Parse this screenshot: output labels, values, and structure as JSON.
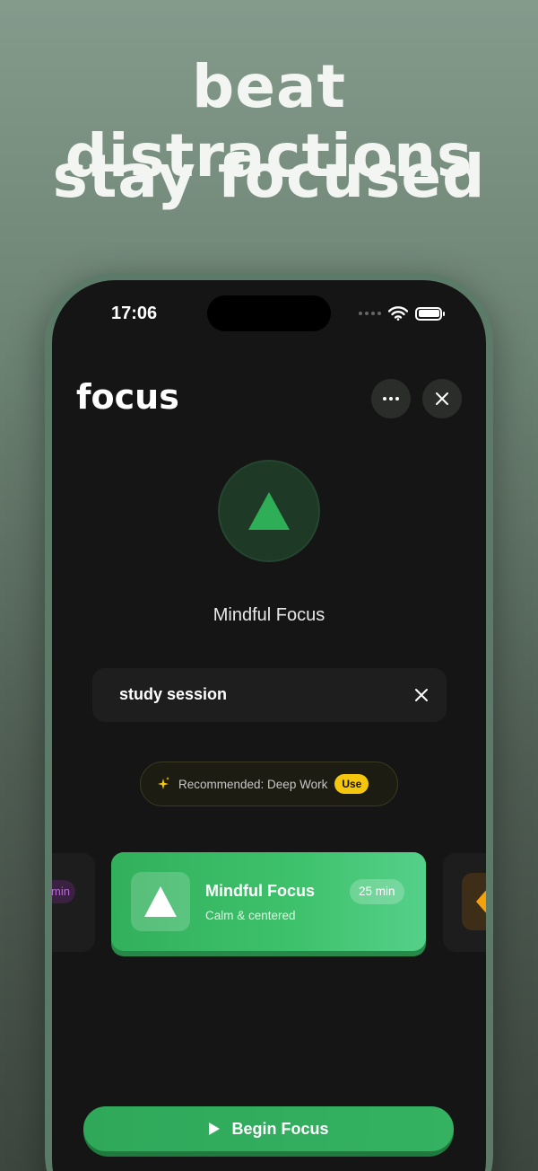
{
  "headline": {
    "line1": "beat distractions",
    "line2": "stay focused"
  },
  "status_bar": {
    "time": "17:06"
  },
  "app": {
    "title": "focus",
    "current_mode": "Mindful Focus",
    "intent": {
      "value": "study session"
    },
    "recommendation": {
      "text": "Recommended: Deep Work",
      "action_label": "Use"
    },
    "side_card_left": {
      "chip": "min"
    },
    "active_card": {
      "title": "Mindful Focus",
      "subtitle": "Calm & centered",
      "duration": "25 min"
    },
    "begin_button": {
      "label": "Begin Focus"
    }
  },
  "icons": {
    "wifi": "wifi-icon",
    "battery": "battery-icon",
    "more": "more-horizontal-icon",
    "close": "close-icon",
    "mode": "triangle-icon",
    "spark": "sparkles-icon",
    "play": "play-icon"
  },
  "colors": {
    "accent": "#34b261",
    "highlight_yellow": "#f5c60e",
    "screen_bg": "#141514"
  }
}
